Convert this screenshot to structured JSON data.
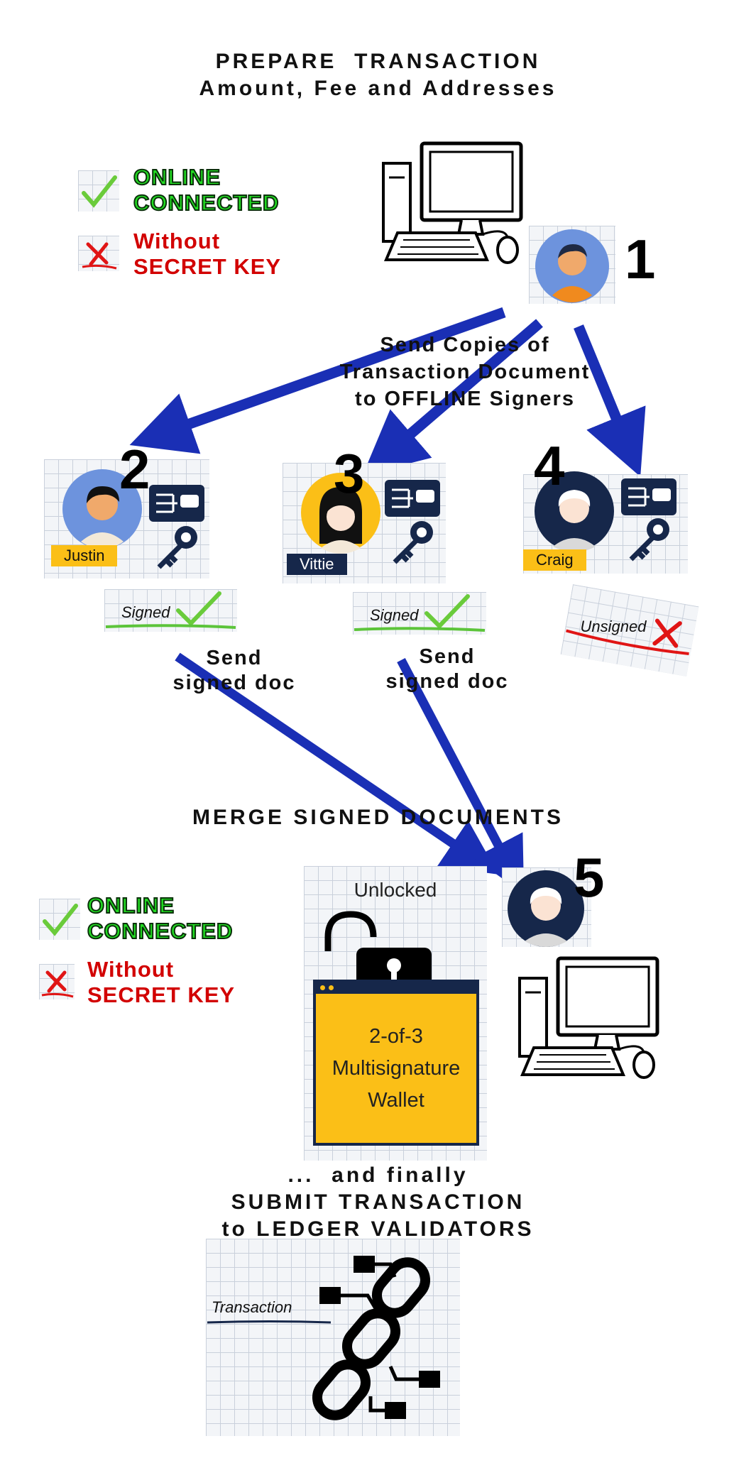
{
  "header": {
    "line1": "PREPARE  TRANSACTION",
    "line2": "Amount, Fee and Addresses"
  },
  "status_top": {
    "online": [
      "ONLINE",
      "CONNECTED"
    ],
    "without": [
      "Without",
      "SECRET KEY"
    ]
  },
  "status_bottom": {
    "online": [
      "ONLINE",
      "CONNECTED"
    ],
    "without": [
      "Without",
      "SECRET KEY"
    ]
  },
  "step_numbers": {
    "one": "1",
    "two": "2",
    "three": "3",
    "four": "4",
    "five": "5"
  },
  "send_copies": [
    "Send Copies of",
    "Transaction Document",
    "to OFFLINE Signers"
  ],
  "signers": [
    {
      "name": "Justin",
      "status": "Signed"
    },
    {
      "name": "Vittie",
      "status": "Signed"
    },
    {
      "name": "Craig",
      "status": "Unsigned"
    }
  ],
  "send_signed": [
    "Send",
    "signed doc"
  ],
  "merge_title": "MERGE SIGNED DOCUMENTS",
  "wallet": {
    "lock_label": "Unlocked",
    "lines": [
      "2-of-3",
      "Multisignature",
      "Wallet"
    ]
  },
  "final": [
    "...  and finally",
    "SUBMIT TRANSACTION",
    "to LEDGER VALIDATORS"
  ],
  "transaction_label": "Transaction",
  "colors": {
    "arrow": "#1a2fb5",
    "green": "#22dd22",
    "red": "#d20000",
    "wallet": "#fbbf17",
    "navy": "#16274a",
    "avatar_blue": "#6d93dd"
  }
}
